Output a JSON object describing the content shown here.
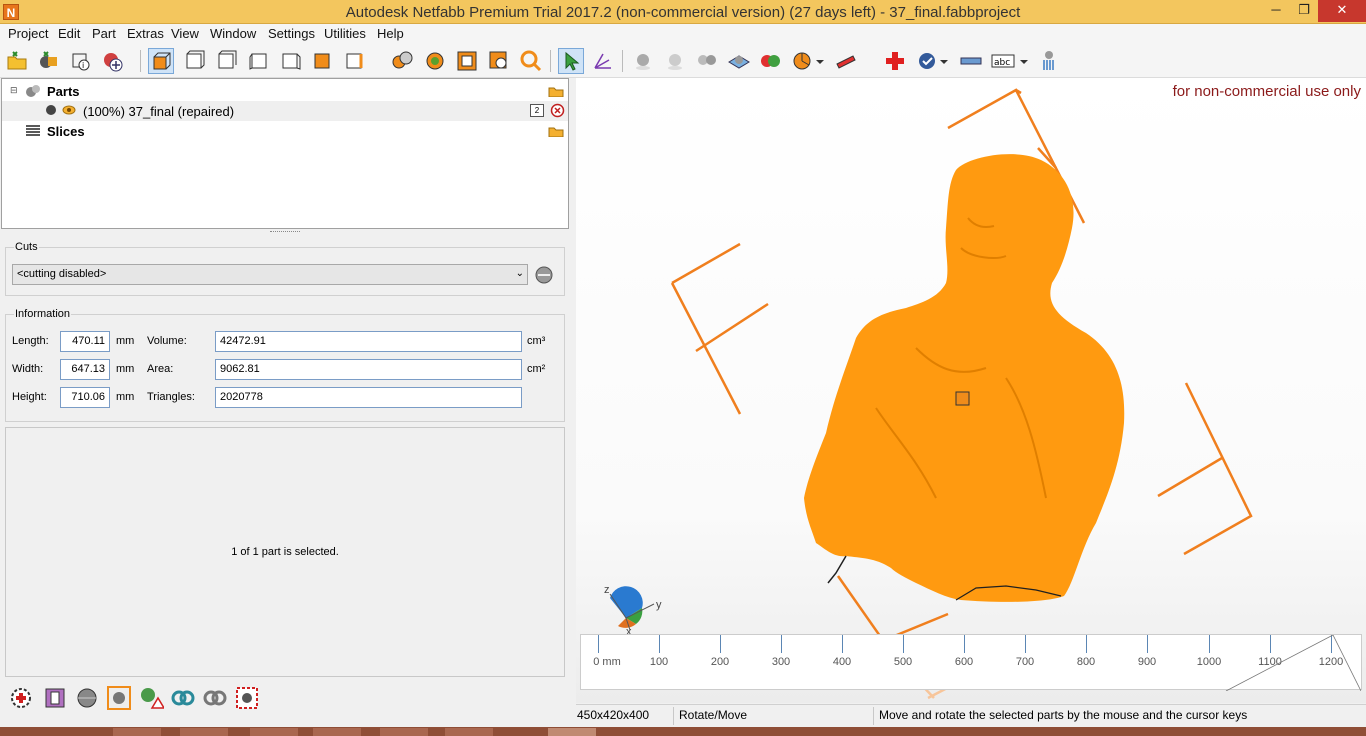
{
  "window": {
    "title": "Autodesk Netfabb Premium Trial 2017.2 (non-commercial version) (27 days left) - 37_final.fabbproject",
    "app_icon": "N"
  },
  "menu": [
    "Project",
    "Edit",
    "Part",
    "Extras",
    "View",
    "Window",
    "Settings",
    "Utilities",
    "Help"
  ],
  "tree": {
    "parts_label": "Parts",
    "part_item": "(100%) 37_final (repaired)",
    "part_badge": "2",
    "slices_label": "Slices"
  },
  "cuts": {
    "title": "Cuts",
    "selected": "<cutting disabled>"
  },
  "information": {
    "title": "Information",
    "length_label": "Length:",
    "length_value": "470.11",
    "width_label": "Width:",
    "width_value": "647.13",
    "height_label": "Height:",
    "height_value": "710.06",
    "dim_unit": "mm",
    "volume_label": "Volume:",
    "volume_value": "42472.91",
    "volume_unit": "cm³",
    "area_label": "Area:",
    "area_value": "9062.81",
    "area_unit": "cm²",
    "triangles_label": "Triangles:",
    "triangles_value": "2020778"
  },
  "selection_message": "1 of 1 part is selected.",
  "viewport": {
    "watermark": "for non-commercial use only",
    "axis_x": "x",
    "axis_y": "y",
    "axis_z": "z",
    "model_color": "#ff9a10",
    "frame_color": "#f07f1e"
  },
  "ruler": {
    "labels": [
      "0 mm",
      "100",
      "200",
      "300",
      "400",
      "500",
      "600",
      "700",
      "800",
      "900",
      "1000",
      "1100",
      "1200"
    ]
  },
  "statusbar": {
    "dimensions": "450x420x400",
    "mode": "Rotate/Move",
    "hint": "Move and rotate the selected parts by the mouse and the cursor keys"
  }
}
